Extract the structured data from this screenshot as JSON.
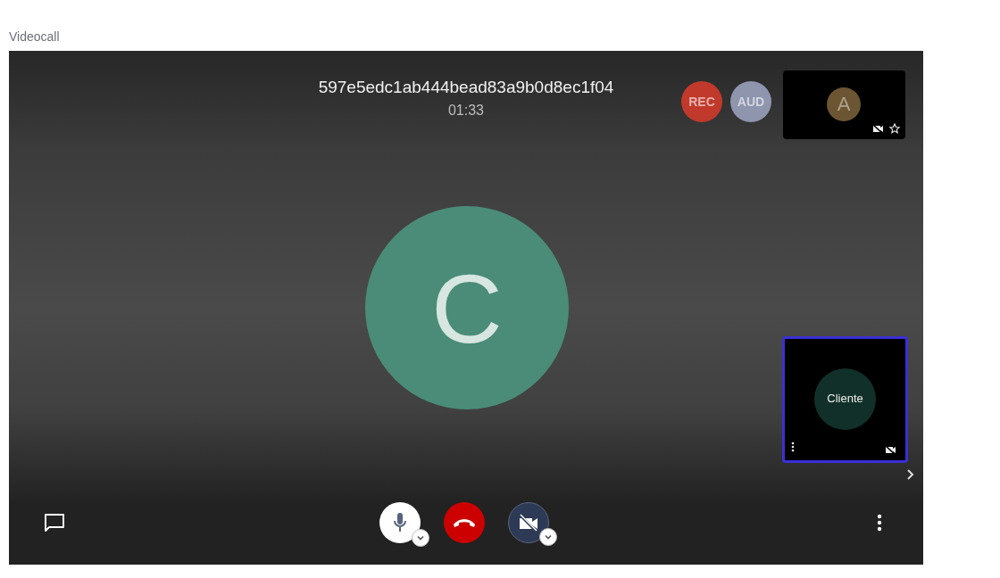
{
  "caption": "Videocall",
  "call": {
    "session_id": "597e5edc1ab444bead83a9b0d8ec1f04",
    "timer": "01:33",
    "main_avatar": {
      "initial": "C",
      "color": "#4a8c78"
    }
  },
  "badges": [
    {
      "label": "REC",
      "color": "#c0392b"
    },
    {
      "label": "AUD",
      "color": "#8e95ad"
    }
  ],
  "tiles": [
    {
      "initial": "A",
      "color": "#6b5532",
      "selected": false,
      "video_off": true,
      "starred": false,
      "menu": false
    },
    {
      "name": "Cliente",
      "color": "#12302a",
      "selected": true,
      "video_off": true,
      "menu": true
    }
  ],
  "controls": {
    "mic_on": true,
    "camera_on": false
  }
}
